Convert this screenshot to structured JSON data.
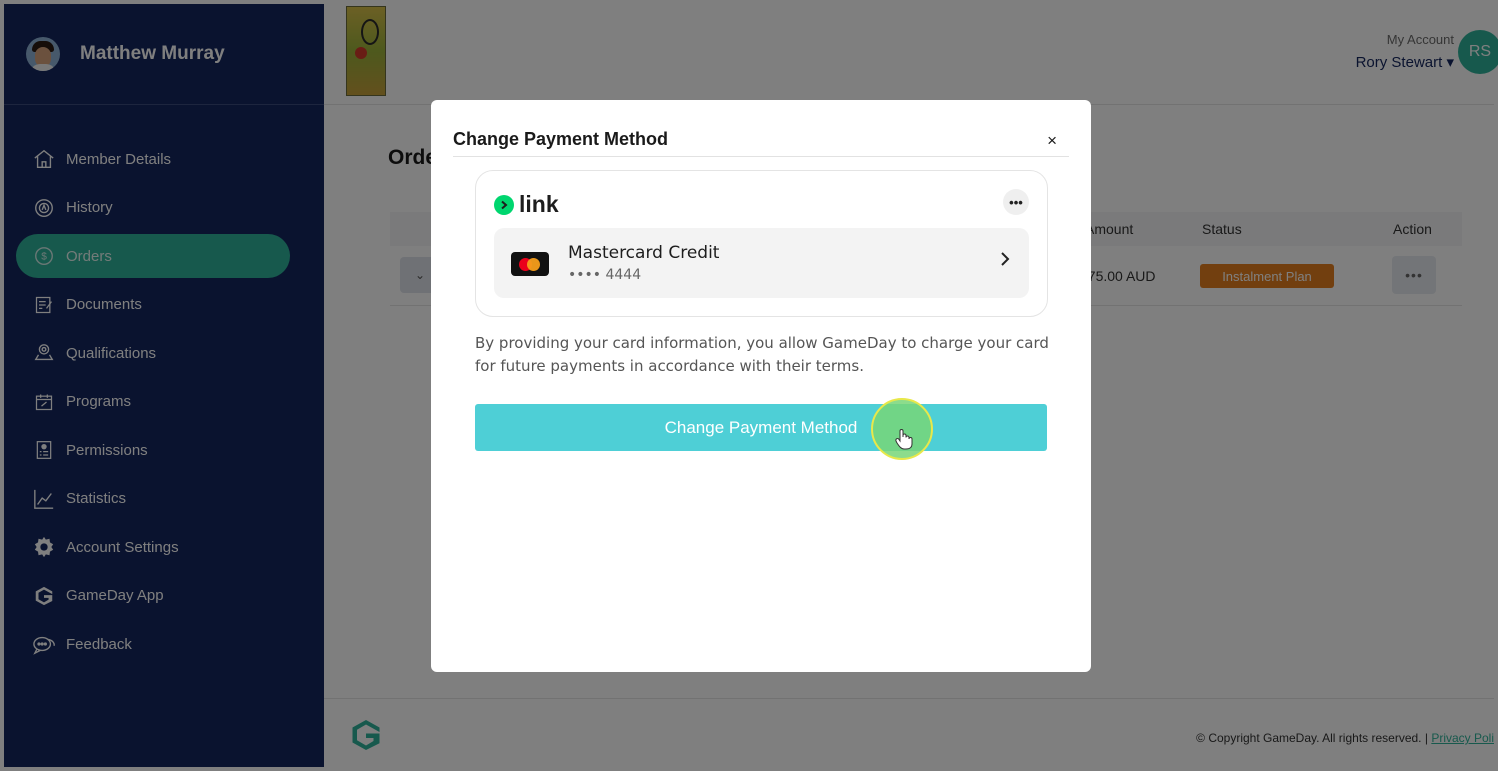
{
  "sidebar": {
    "user_name": "Matthew Murray",
    "items": [
      {
        "label": "Member Details",
        "icon": "home-icon"
      },
      {
        "label": "History",
        "icon": "history-icon"
      },
      {
        "label": "Orders",
        "icon": "dollar-icon",
        "active": true
      },
      {
        "label": "Documents",
        "icon": "document-icon"
      },
      {
        "label": "Qualifications",
        "icon": "qualification-icon"
      },
      {
        "label": "Programs",
        "icon": "calendar-icon"
      },
      {
        "label": "Permissions",
        "icon": "permissions-icon"
      },
      {
        "label": "Statistics",
        "icon": "chart-icon"
      },
      {
        "label": "Account Settings",
        "icon": "gear-icon"
      },
      {
        "label": "GameDay App",
        "icon": "gameday-icon"
      },
      {
        "label": "Feedback",
        "icon": "feedback-icon"
      }
    ]
  },
  "header": {
    "account_label": "My Account",
    "account_name": "Rory Stewart",
    "account_initials": "RS"
  },
  "main": {
    "title": "Orde",
    "table": {
      "headers": [
        "Amount",
        "Status",
        "Action"
      ],
      "rows": [
        {
          "amount": "$75.00 AUD",
          "status": "Instalment Plan",
          "action": "•••"
        }
      ]
    }
  },
  "footer": {
    "copyright": "© Copyright GameDay. All rights reserved. |",
    "privacy_link": "Privacy Poli"
  },
  "modal": {
    "title": "Change Payment Method",
    "close": "×",
    "link_brand": "link",
    "more": "•••",
    "card": {
      "name": "Mastercard Credit",
      "number": "•••• 4444"
    },
    "disclaimer": "By providing your card information, you allow GameDay to charge your card for future payments in accordance with their terms.",
    "button": "Change Payment Method"
  },
  "colors": {
    "sidebar": "#15265e",
    "accent": "#2fb39a",
    "button": "#4ecfd6",
    "badge": "#e57e1e",
    "link_green": "#00d66f"
  }
}
